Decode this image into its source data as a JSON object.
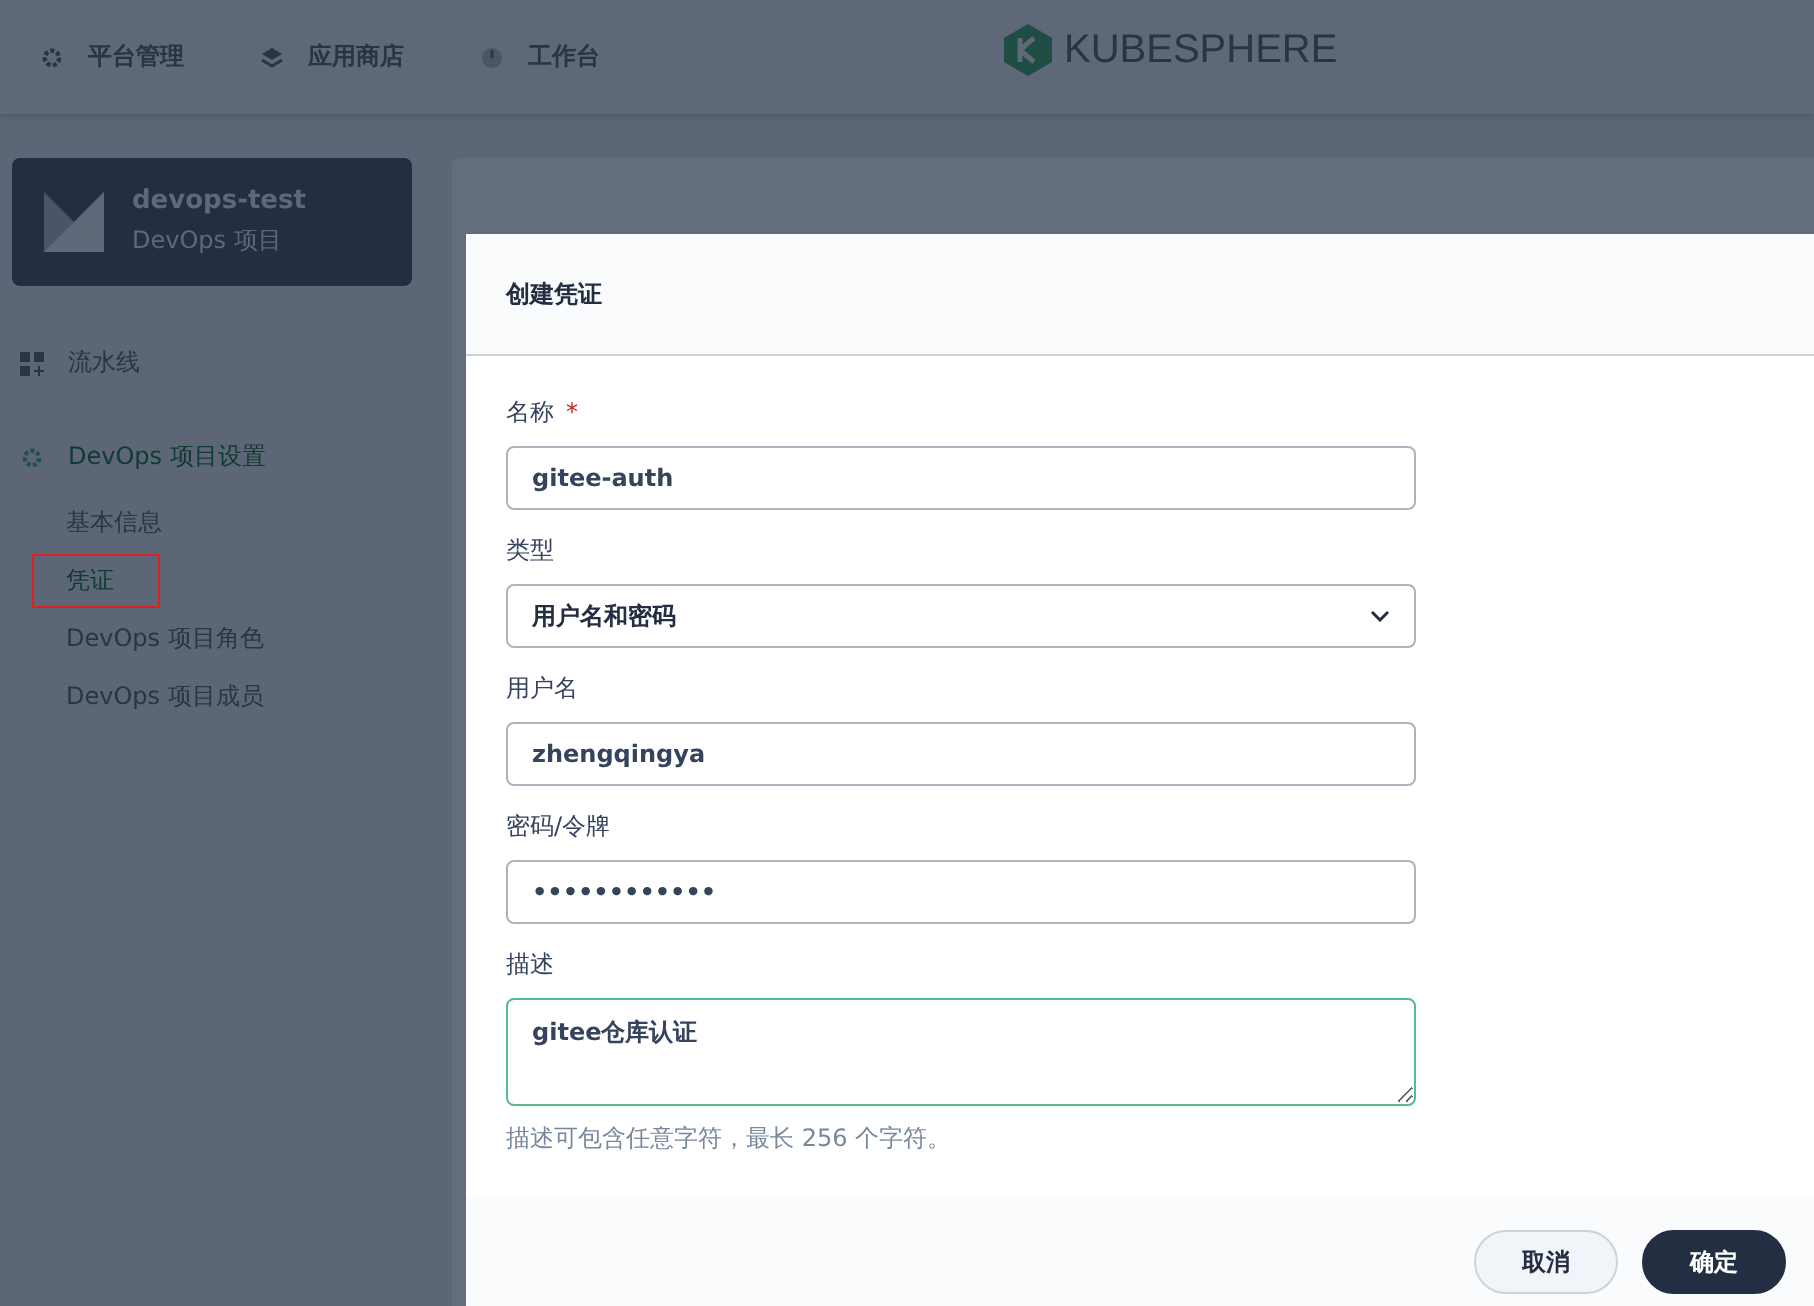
{
  "top_nav": [
    {
      "label": "平台管理"
    },
    {
      "label": "应用商店"
    },
    {
      "label": "工作台"
    }
  ],
  "logo": {
    "text": "KUBESPHERE"
  },
  "project": {
    "name": "devops-test",
    "type": "DevOps 项目"
  },
  "sidebar": [
    {
      "label": "流水线",
      "selected": false
    },
    {
      "label": "DevOps 项目设置",
      "selected": true,
      "children": [
        {
          "label": "基本信息",
          "selected": false,
          "highlighted": false
        },
        {
          "label": "凭证",
          "selected": true,
          "highlighted": true
        },
        {
          "label": "DevOps 项目角色",
          "selected": false,
          "highlighted": false
        },
        {
          "label": "DevOps 项目成员",
          "selected": false,
          "highlighted": false
        }
      ]
    }
  ],
  "dialog": {
    "title": "创建凭证",
    "fields": [
      {
        "label": "名称",
        "required_mark": "*",
        "kind": "input",
        "value": "gitee-auth"
      },
      {
        "label": "类型",
        "kind": "select",
        "value": "用户名和密码"
      },
      {
        "label": "用户名",
        "kind": "input",
        "value": "zhengqingya"
      },
      {
        "label": "密码/令牌",
        "kind": "password",
        "value": "••••••••••••"
      },
      {
        "label": "描述",
        "kind": "textarea",
        "value": "gitee仓库认证",
        "focused": true,
        "hint": "描述可包含任意字符，最长 256 个字符。"
      }
    ],
    "buttons": [
      {
        "label": "取消",
        "kind": "secondary"
      },
      {
        "label": "确定",
        "kind": "primary"
      }
    ]
  }
}
